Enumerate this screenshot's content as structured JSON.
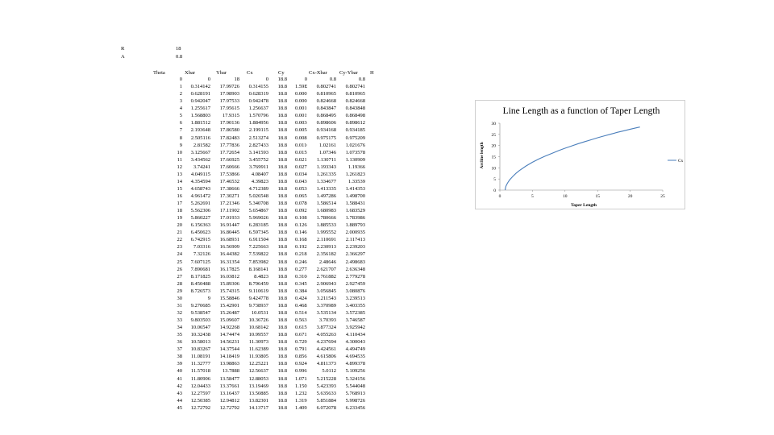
{
  "params": [
    {
      "label": "R",
      "value": "18"
    },
    {
      "label": "A",
      "value": "0.8"
    }
  ],
  "table": {
    "headers": [
      "Theta",
      "Xbar",
      "Ybar",
      "Cx",
      "Cy",
      "Cx-Xbar",
      "Cy-Ybar",
      "H"
    ],
    "rows": [
      [
        "0",
        "0",
        "18",
        "0",
        "18.8",
        "0",
        "0.8",
        "0.8"
      ],
      [
        "1",
        "0.314142",
        "17.99726",
        "0.314155",
        "18.8",
        "1.59E-05",
        "0.802741",
        "0.802741"
      ],
      [
        "2",
        "0.628191",
        "17.98903",
        "0.628319",
        "18.8",
        "0.000128",
        "0.810965",
        "0.810965"
      ],
      [
        "3",
        "0.942047",
        "17.97533",
        "0.942478",
        "18.8",
        "0.000431",
        "0.824668",
        "0.824668"
      ],
      [
        "4",
        "1.255617",
        "17.95615",
        "1.256637",
        "18.8",
        "0.00102",
        "0.843847",
        "0.843848"
      ],
      [
        "5",
        "1.568803",
        "17.9315",
        "1.570796",
        "18.8",
        "0.001993",
        "0.868495",
        "0.868498"
      ],
      [
        "6",
        "1.881512",
        "17.90136",
        "1.884956",
        "18.8",
        "0.003443",
        "0.898606",
        "0.898612"
      ],
      [
        "7",
        "2.193648",
        "17.86580",
        "2.199115",
        "18.8",
        "0.005467",
        "0.934168",
        "0.934185"
      ],
      [
        "8",
        "2.505116",
        "17.82483",
        "2.513274",
        "18.8",
        "0.008158",
        "0.975175",
        "0.975209"
      ],
      [
        "9",
        "2.81582",
        "17.77836",
        "2.827433",
        "18.8",
        "0.011613",
        "1.02161",
        "1.021676"
      ],
      [
        "10",
        "3.125667",
        "17.72654",
        "3.141593",
        "18.8",
        "0.015925",
        "1.07346",
        "1.073578"
      ],
      [
        "11",
        "3.434562",
        "17.66925",
        "3.455752",
        "18.8",
        "0.02119",
        "1.130711",
        "1.130909"
      ],
      [
        "12",
        "3.74241",
        "17.60666",
        "3.769911",
        "18.8",
        "0.027501",
        "1.193343",
        "1.19366"
      ],
      [
        "13",
        "4.049115",
        "17.53866",
        "4.08407",
        "18.8",
        "0.034951",
        "1.261335",
        "1.261823"
      ],
      [
        "14",
        "4.354594",
        "17.46532",
        "4.39823",
        "18.8",
        "0.043636",
        "1.334677",
        "1.33539"
      ],
      [
        "15",
        "4.658743",
        "17.38666",
        "4.712389",
        "18.8",
        "0.053646",
        "1.413335",
        "1.414353"
      ],
      [
        "16",
        "4.961472",
        "17.30271",
        "5.026548",
        "18.8",
        "0.065076",
        "1.497286",
        "1.498700"
      ],
      [
        "17",
        "5.262691",
        "17.21346",
        "5.340708",
        "18.8",
        "0.078017",
        "1.586514",
        "1.588431"
      ],
      [
        "18",
        "5.562306",
        "17.11902",
        "5.654867",
        "18.8",
        "0.092561",
        "1.680983",
        "1.683529"
      ],
      [
        "19",
        "5.860227",
        "17.01933",
        "5.969026",
        "18.8",
        "0.108799",
        "1.780666",
        "1.783986"
      ],
      [
        "20",
        "6.156363",
        "16.91447",
        "6.283185",
        "18.8",
        "0.126823",
        "1.885533",
        "1.889793"
      ],
      [
        "21",
        "6.450623",
        "16.80445",
        "6.597345",
        "18.8",
        "0.146721",
        "1.995552",
        "2.000935"
      ],
      [
        "22",
        "6.742915",
        "16.68931",
        "6.911504",
        "18.8",
        "0.168585",
        "2.110691",
        "2.117413"
      ],
      [
        "23",
        "7.03316",
        "16.56909",
        "7.225663",
        "18.8",
        "0.192503",
        "2.230913",
        "2.239203"
      ],
      [
        "24",
        "7.32126",
        "16.44382",
        "7.539822",
        "18.8",
        "0.218563",
        "2.356182",
        "2.366297"
      ],
      [
        "25",
        "7.607125",
        "16.31354",
        "7.853982",
        "18.8",
        "0.246853",
        "2.48646",
        "2.498683"
      ],
      [
        "26",
        "7.890681",
        "16.17825",
        "8.168141",
        "18.8",
        "0.27746",
        "2.621707",
        "2.636348"
      ],
      [
        "27",
        "8.171825",
        "16.03812",
        "8.4823",
        "18.8",
        "0.310471",
        "2.761882",
        "2.779278"
      ],
      [
        "28",
        "8.450488",
        "15.89306",
        "8.796459",
        "18.8",
        "0.345971",
        "2.906943",
        "2.927459"
      ],
      [
        "29",
        "8.726573",
        "15.74315",
        "9.110619",
        "18.8",
        "0.384046",
        "3.056845",
        "3.080876"
      ],
      [
        "30",
        "9",
        "15.58846",
        "9.424778",
        "18.8",
        "0.424778",
        "3.211543",
        "3.239513"
      ],
      [
        "31",
        "9.270685",
        "15.42901",
        "9.738937",
        "18.8",
        "0.468252",
        "3.370989",
        "3.403355"
      ],
      [
        "32",
        "9.538547",
        "15.26487",
        "10.0531",
        "18.8",
        "0.51455",
        "3.535134",
        "3.572385"
      ],
      [
        "33",
        "9.803503",
        "15.09607",
        "10.36726",
        "18.8",
        "0.563753",
        "3.70393",
        "3.746587"
      ],
      [
        "34",
        "10.06547",
        "14.92268",
        "10.68142",
        "18.8",
        "0.615943",
        "3.877324",
        "3.925942"
      ],
      [
        "35",
        "10.32438",
        "14.74474",
        "10.99557",
        "18.8",
        "0.671198",
        "4.055263",
        "4.110434"
      ],
      [
        "36",
        "10.58013",
        "14.56231",
        "11.30973",
        "18.8",
        "0.729599",
        "4.237694",
        "4.300043"
      ],
      [
        "37",
        "10.83267",
        "14.37544",
        "11.62389",
        "18.8",
        "0.791222",
        "4.424561",
        "4.494749"
      ],
      [
        "38",
        "11.08191",
        "14.18419",
        "11.93805",
        "18.8",
        "0.856146",
        "4.615806",
        "4.694535"
      ],
      [
        "39",
        "11.32777",
        "13.98863",
        "12.25221",
        "18.8",
        "0.924444",
        "4.811373",
        "4.899378"
      ],
      [
        "40",
        "11.57018",
        "13.7888",
        "12.56637",
        "18.8",
        "0.996194",
        "5.0112",
        "5.109256"
      ],
      [
        "41",
        "11.80906",
        "13.58477",
        "12.88053",
        "18.8",
        "1.071467",
        "5.215228",
        "5.324156"
      ],
      [
        "42",
        "12.04433",
        "13.37661",
        "13.19469",
        "18.8",
        "1.150358",
        "5.423393",
        "5.544048"
      ],
      [
        "43",
        "12.27597",
        "13.16437",
        "13.50885",
        "18.8",
        "1.232878",
        "5.635633",
        "5.768913"
      ],
      [
        "44",
        "12.50385",
        "12.94812",
        "13.82301",
        "18.8",
        "1.319157",
        "5.851884",
        "5.998726"
      ],
      [
        "45",
        "12.72792",
        "12.72792",
        "14.13717",
        "18.8",
        "1.409245",
        "6.072078",
        "6.233456"
      ]
    ]
  },
  "chart_data": {
    "type": "line",
    "title": "Line Length as a function of Taper Length",
    "xlabel": "Taper Length",
    "ylabel": "Arcline length",
    "xlim": [
      0,
      25
    ],
    "ylim": [
      0,
      30
    ],
    "xticks": [
      "0",
      "5",
      "10",
      "15",
      "20",
      "25"
    ],
    "yticks": [
      "0",
      "5",
      "10",
      "15",
      "20",
      "25",
      "30"
    ],
    "legend": "right",
    "grid": false,
    "series": [
      {
        "name": "Cx",
        "color": "#4a7ebb",
        "x": [
          0.8,
          0.9,
          1.0,
          1.2,
          1.5,
          2.0,
          2.5,
          3.0,
          4.0,
          5.0,
          6.0,
          7.0,
          8.0,
          9.0,
          10.0,
          11.0,
          12.0,
          13.0,
          14.0,
          15.0,
          16.0,
          17.0,
          18.0,
          19.0,
          20.0,
          21.0,
          21.5
        ],
        "y": [
          0,
          1.5,
          2.2,
          3.3,
          4.6,
          6.2,
          7.6,
          8.8,
          10.8,
          12.5,
          14.0,
          15.3,
          16.5,
          17.7,
          18.8,
          19.8,
          20.8,
          21.7,
          22.6,
          23.5,
          24.3,
          25.1,
          25.9,
          26.6,
          27.3,
          28.0,
          28.3
        ]
      }
    ]
  }
}
